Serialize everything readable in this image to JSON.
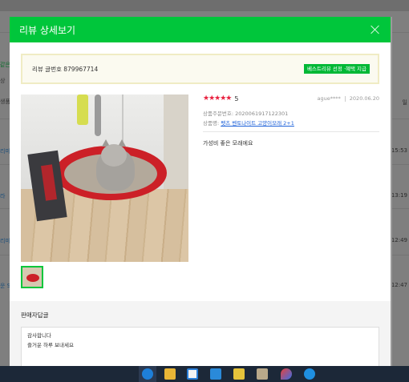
{
  "background": {
    "left_labels": [
      "같은",
      "상",
      "생품",
      "리미",
      "라",
      "리미",
      "운 S"
    ],
    "right_labels": [
      "일",
      "15:53",
      "13:19",
      "12:49",
      "12:47"
    ]
  },
  "modal": {
    "title": "리뷰 상세보기",
    "close_icon": "close-icon"
  },
  "review": {
    "number_label": "리뷰 글번호 879967714",
    "best_badge": "베스트리뷰 선정 ·혜택 지급",
    "stars": "★★★★★",
    "score": "5",
    "author": "ague****",
    "date": "2020.06.20",
    "order_no": "상품주문번호: 2020061917122301",
    "product_prefix": "상품명: ",
    "product_name": "펫츠 벤토나이트 고양이모래 2+1",
    "text": "가성비 좋은 모래에요"
  },
  "reply": {
    "title": "판매자답글",
    "text": "감사합니다\n즐거운 하루 보내세요"
  },
  "colors": {
    "header_green": "#00c63b",
    "star_red": "#e8213f",
    "link_blue": "#1d61d9"
  },
  "taskbar": {
    "icons": [
      "edge-icon",
      "file-explorer-icon",
      "store-icon",
      "mail-icon",
      "app-icon",
      "app-icon-2",
      "paint-icon",
      "ie-icon"
    ]
  }
}
